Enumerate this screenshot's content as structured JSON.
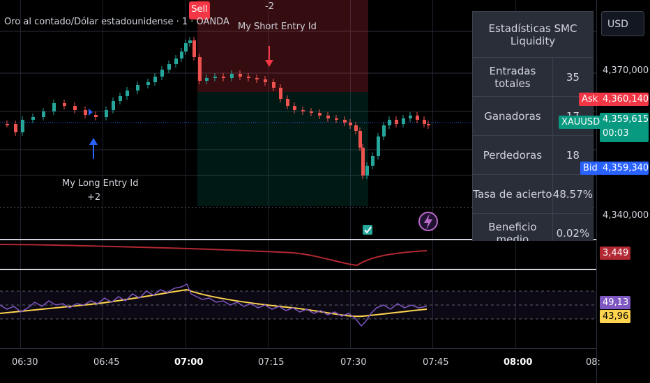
{
  "header": {
    "symbol_title": "Oro al contado/Dólar estadounidense · 1 · OANDA"
  },
  "toolbar": {
    "currency_label": "USD"
  },
  "chart_annotations": {
    "sell_label": "Sell",
    "short_entry_count": "-2",
    "short_entry_label": "My Short Entry Id",
    "long_entry_label": "My Long Entry Id",
    "long_entry_count": "+2"
  },
  "price_axis": {
    "labels": [
      "4,370,000",
      "4,340,000"
    ],
    "ask_label": "Ask",
    "ask_value": "4,360,140",
    "symbol_badge": "XAUUSD",
    "last_value": "4,359,615",
    "countdown": "00:03",
    "bid_label": "Bid",
    "bid_value": "4,359,340",
    "indicator1_value": "3,449",
    "indicator2_value_a": "49,13",
    "indicator2_value_b": "43,96"
  },
  "time_axis": {
    "labels": [
      "06:30",
      "06:45",
      "07:00",
      "07:15",
      "07:30",
      "07:45",
      "08:00",
      "08:"
    ]
  },
  "stats_table": {
    "title": "Estadísticas SMC Liquidity",
    "rows": [
      {
        "label": "Entradas totales",
        "value": "35"
      },
      {
        "label": "Ganadoras",
        "value": "17"
      },
      {
        "label": "Perdedoras",
        "value": "18"
      },
      {
        "label": "Tasa de acierto",
        "value": "48.57%"
      },
      {
        "label": "Beneficio medio",
        "value": "0.02%"
      }
    ]
  },
  "colors": {
    "up": "#26a69a",
    "down": "#ef5350",
    "ask": "#f23645",
    "bid": "#2962ff",
    "symbol_badge": "#089981",
    "indicator1": "#b22833",
    "rsi_line": "#7e57c2",
    "rsi_ma": "#ffd54f"
  }
}
